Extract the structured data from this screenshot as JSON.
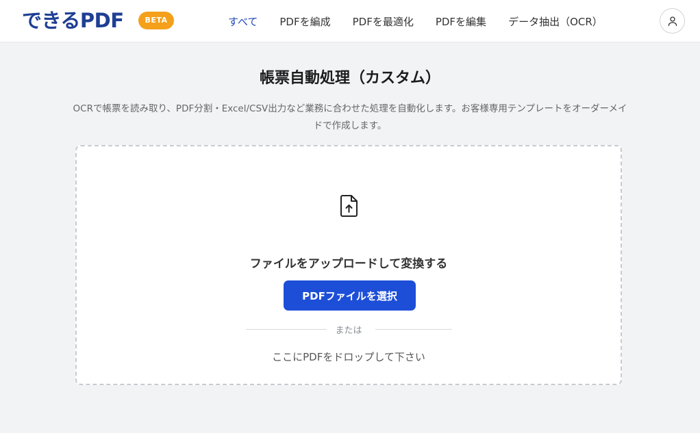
{
  "header": {
    "logo": "できるPDF",
    "beta": "BETA",
    "nav": [
      {
        "label": "すべて",
        "active": true
      },
      {
        "label": "PDFを編成",
        "active": false
      },
      {
        "label": "PDFを最適化",
        "active": false
      },
      {
        "label": "PDFを編集",
        "active": false
      },
      {
        "label": "データ抽出（OCR）",
        "active": false
      }
    ],
    "avatar_icon": "user-icon"
  },
  "main": {
    "title": "帳票自動処理（カスタム）",
    "description": "OCRで帳票を読み取り、PDF分割・Excel/CSV出力など業務に合わせた処理を自動化します。お客様専用テンプレートをオーダーメイドで作成します。"
  },
  "dropzone": {
    "icon": "file-upload-icon",
    "label": "ファイルをアップロードして変換する",
    "button": "PDFファイルを選択",
    "or": "または",
    "drop_text": "ここにPDFをドロップして下さい"
  },
  "colors": {
    "primary": "#1d4ed8",
    "logo": "#1f3f94",
    "beta": "#f5a01a",
    "background": "#f2f3f5"
  }
}
